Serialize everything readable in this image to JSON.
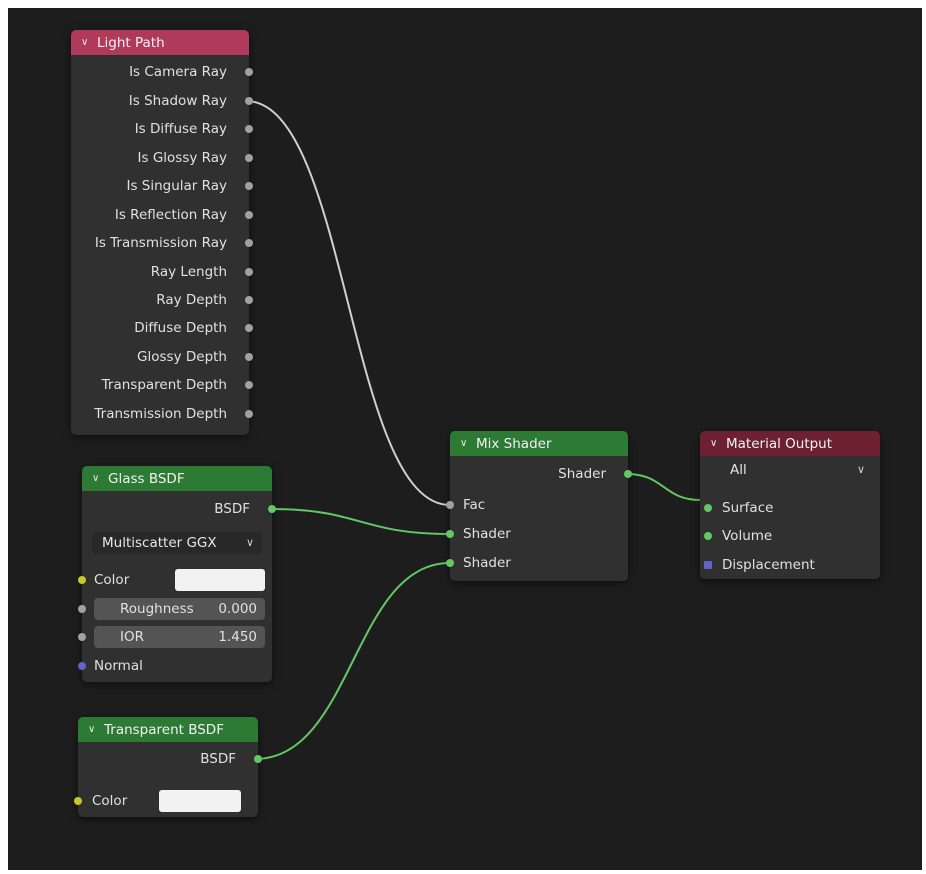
{
  "colors": {
    "editor_bg": "#1d1d1d",
    "node_bg": "#303030",
    "input_header": "#b03a59",
    "shader_header": "#2c7a34",
    "output_header": "#6d2030",
    "socket_float": "#a1a1a1",
    "socket_shader": "#63c763",
    "socket_color": "#c7c729",
    "socket_vector": "#6363c7",
    "wire_grey": "#cfcfcf",
    "wire_green": "#63c763"
  },
  "light_path": {
    "title": "Light Path",
    "outputs": [
      "Is Camera Ray",
      "Is Shadow Ray",
      "Is Diffuse Ray",
      "Is Glossy Ray",
      "Is Singular Ray",
      "Is Reflection Ray",
      "Is Transmission Ray",
      "Ray Length",
      "Ray Depth",
      "Diffuse Depth",
      "Glossy Depth",
      "Transparent Depth",
      "Transmission Depth"
    ]
  },
  "glass_bsdf": {
    "title": "Glass BSDF",
    "output": "BSDF",
    "distribution": "Multiscatter GGX",
    "color_label": "Color",
    "roughness_label": "Roughness",
    "roughness_value": "0.000",
    "ior_label": "IOR",
    "ior_value": "1.450",
    "normal_label": "Normal"
  },
  "transparent_bsdf": {
    "title": "Transparent BSDF",
    "output": "BSDF",
    "color_label": "Color"
  },
  "mix_shader": {
    "title": "Mix Shader",
    "output": "Shader",
    "fac_label": "Fac",
    "shader1_label": "Shader",
    "shader2_label": "Shader"
  },
  "material_output": {
    "title": "Material Output",
    "target": "All",
    "surface_label": "Surface",
    "volume_label": "Volume",
    "displacement_label": "Displacement"
  }
}
